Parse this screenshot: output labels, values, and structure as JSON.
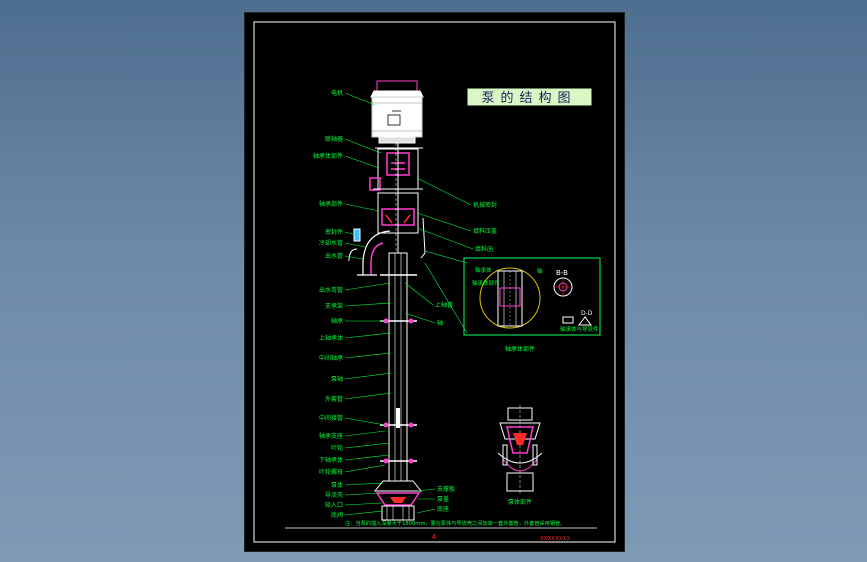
{
  "title_block": {
    "title": "泵的结构图"
  },
  "footer": {
    "page_number": "4",
    "drawing_code": "XXXXXXXX"
  },
  "note": "注：当泵的插入深度大于1800mm，要在泵体与导流壳之间加装一套外套管，外套管采用钢管。",
  "left_callouts": [
    "电机",
    "联轴器",
    "轴承体部件",
    "轴承部件",
    "密封件",
    "冷却水管",
    "出水管",
    "出水弯管",
    "支承架",
    "轴承",
    "上轴承体",
    "中间轴承",
    "泵轴",
    "外套管",
    "中间接管",
    "轴承支座",
    "叶轮",
    "下轴承体",
    "叶轮螺母",
    "泵体",
    "导流壳",
    "吸入口",
    "底阀"
  ],
  "right_callouts": [
    "机械密封",
    "填料压盖",
    "填料函",
    "上轴管",
    "轴",
    "支撑板",
    "泵盖",
    "底座"
  ],
  "detail_view": {
    "callouts": [
      "轴承体",
      "轴承体部件",
      "轴"
    ],
    "section_bb": "B-B",
    "section_dd": "D-D",
    "section_dd_caption": "轴承体与导流件",
    "caption": "轴承体部件"
  },
  "secondary_view": {
    "caption": "泵体部件"
  },
  "colors": {
    "frame": "#ffffff",
    "lines": "#ffffff",
    "labels": "#00ff3c",
    "leaders": "#00ff3c",
    "parts": "#ff3fd0",
    "detail_box": "#00ff66",
    "accent_red": "#ff2a2a",
    "title_bg": "#d9f7c4"
  }
}
